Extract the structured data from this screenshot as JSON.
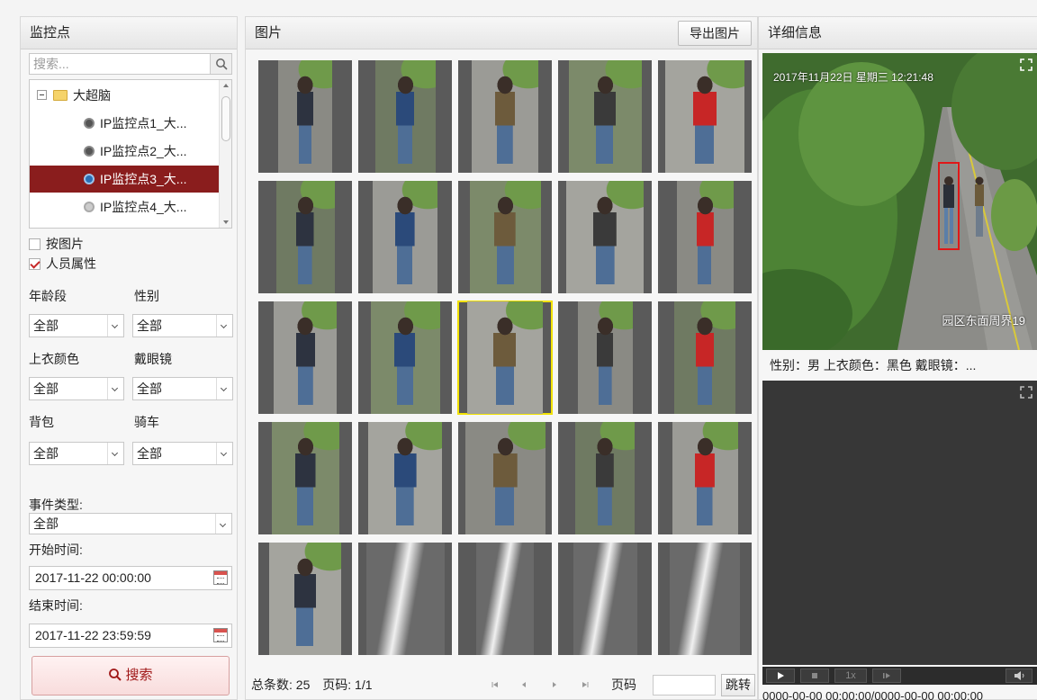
{
  "left_panel": {
    "title": "监控点",
    "search_placeholder": "搜索...",
    "tree": {
      "root_label": "大超脑",
      "items": [
        {
          "label": "IP监控点1_大..."
        },
        {
          "label": "IP监控点2_大..."
        },
        {
          "label": "IP监控点3_大..."
        },
        {
          "label": "IP监控点4_大..."
        }
      ],
      "selected_index": 2
    },
    "mode": {
      "by_image_label": "按图片",
      "by_image_checked": false,
      "person_attr_label": "人员属性",
      "person_attr_checked": true
    },
    "filters": {
      "age_label": "年龄段",
      "age_value": "全部",
      "gender_label": "性别",
      "gender_value": "全部",
      "top_color_label": "上衣颜色",
      "top_color_value": "全部",
      "glasses_label": "戴眼镜",
      "glasses_value": "全部",
      "backpack_label": "背包",
      "backpack_value": "全部",
      "riding_label": "骑车",
      "riding_value": "全部",
      "event_type_label": "事件类型:",
      "event_type_value": "全部"
    },
    "time": {
      "start_label": "开始时间:",
      "start_value": "2017-11-22 00:00:00",
      "end_label": "结束时间:",
      "end_value": "2017-11-22 23:59:59"
    },
    "search_button": "搜索"
  },
  "center_panel": {
    "title": "图片",
    "export_button": "导出图片",
    "selected_thumb_index": 12,
    "footer": {
      "total_label": "总条数: 25",
      "page_label": "页码: 1/1",
      "page_input_label": "页码",
      "page_input_value": "",
      "jump_button": "跳转"
    }
  },
  "right_panel": {
    "title": "详细信息",
    "osd_timestamp": "2017年11月22日 星期三 12:21:48",
    "osd_location": "园区东面周界19",
    "attributes": "性别：男  上衣颜色：黑色  戴眼镜：...",
    "playback": {
      "speed_label": "1x"
    },
    "time_range": "0000-00-00 00:00:00/0000-00-00 00:00:00"
  },
  "colors": {
    "selected_row": "#8a1d1d",
    "selected_thumb_border": "#f2e200",
    "search_text": "#a01818",
    "checkbox_mark": "#c62828"
  }
}
